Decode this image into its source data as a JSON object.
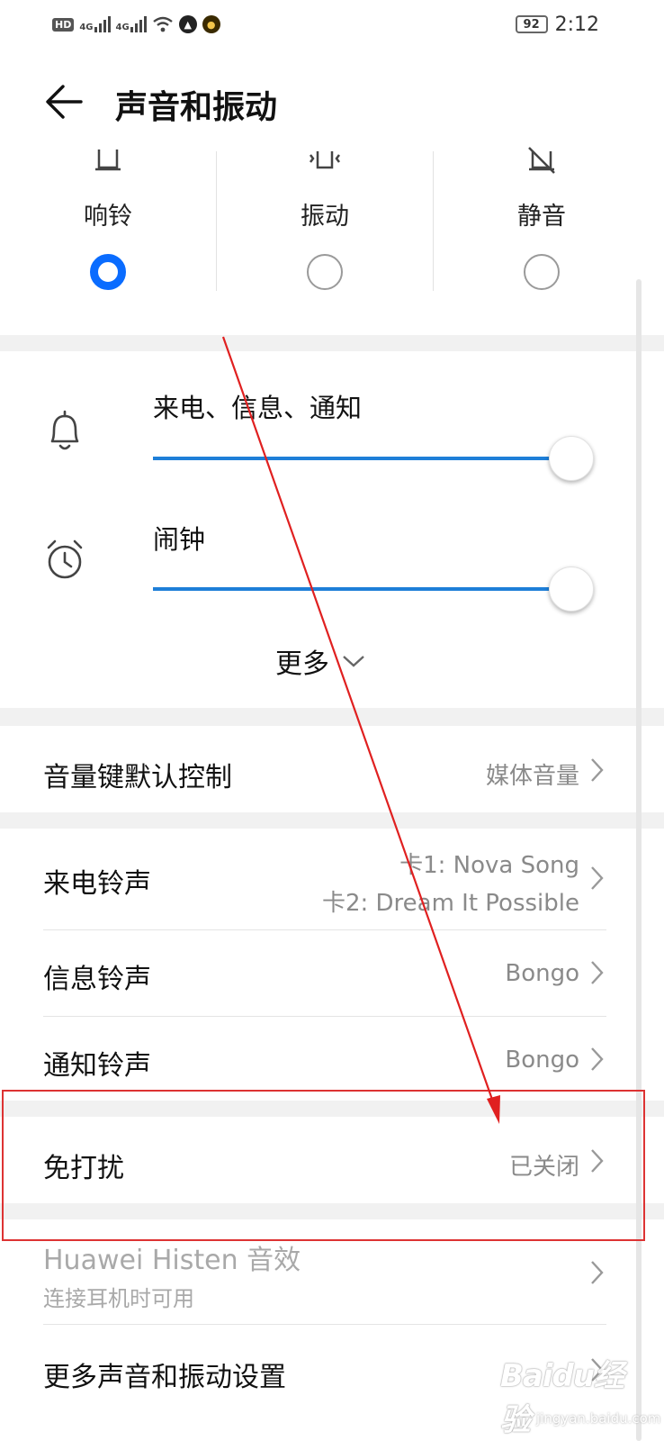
{
  "status_bar": {
    "hd": "HD",
    "sim1_network": "4G",
    "sim2_network": "4G",
    "battery": "92",
    "time": "2:12"
  },
  "header": {
    "title": "声音和振动"
  },
  "modes": [
    {
      "label": "响铃",
      "icon": "bell-icon",
      "selected": true
    },
    {
      "label": "振动",
      "icon": "vibrate-icon",
      "selected": false
    },
    {
      "label": "静音",
      "icon": "bell-off-icon",
      "selected": false
    }
  ],
  "volume": {
    "ring": {
      "label": "来电、信息、通知",
      "level": 1.0
    },
    "alarm": {
      "label": "闹钟",
      "level": 1.0
    },
    "more_label": "更多"
  },
  "settings": {
    "volume_key": {
      "label": "音量键默认控制",
      "value": "媒体音量"
    },
    "ringtone": {
      "label": "来电铃声",
      "value_sim1": "卡1: Nova Song",
      "value_sim2": "卡2: Dream It Possible"
    },
    "message_tone": {
      "label": "信息铃声",
      "value": "Bongo"
    },
    "notification_tone": {
      "label": "通知铃声",
      "value": "Bongo"
    },
    "dnd": {
      "label": "免打扰",
      "value": "已关闭"
    },
    "histen": {
      "label": "Huawei Histen 音效",
      "subtitle": "连接耳机时可用"
    },
    "more_settings": {
      "label": "更多声音和振动设置"
    }
  },
  "watermark": {
    "text": "Baidu经验",
    "sub": "jingyan.baidu.com"
  },
  "colors": {
    "accent": "#0a6cff",
    "slider": "#1e7fd8",
    "annotation": "#dd3333"
  }
}
